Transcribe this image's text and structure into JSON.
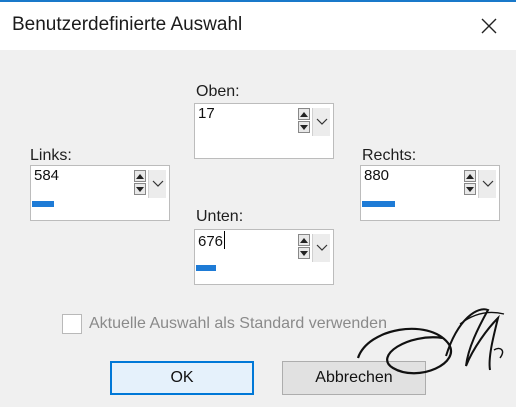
{
  "dialog": {
    "title": "Benutzerdefinierte Auswahl",
    "close_icon": "close-icon"
  },
  "fields": {
    "oben": {
      "label": "Oben:",
      "value": "17",
      "progress": 0.0
    },
    "links": {
      "label": "Links:",
      "value": "584",
      "progress": 0.22
    },
    "rechts": {
      "label": "Rechts:",
      "value": "880",
      "progress": 0.33
    },
    "unten": {
      "label": "Unten:",
      "value": "676",
      "progress": 0.2
    }
  },
  "checkbox": {
    "label": "Aktuelle Auswahl als Standard verwenden",
    "checked": false,
    "enabled": false
  },
  "buttons": {
    "ok": "OK",
    "cancel": "Abbrechen"
  },
  "colors": {
    "accent": "#1e7bd6",
    "window_background": "#f0f0f0",
    "titlebar_background": "#ffffff",
    "disabled_text": "#8a8a8a"
  }
}
